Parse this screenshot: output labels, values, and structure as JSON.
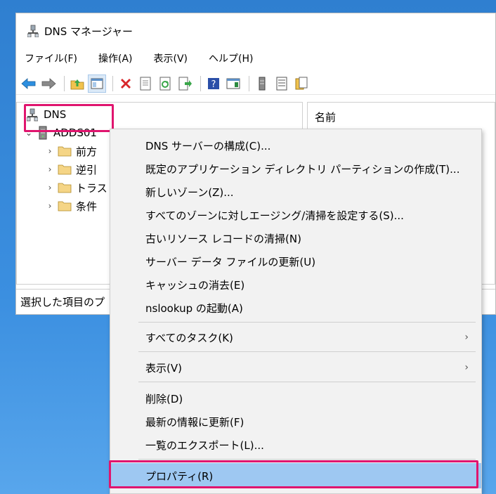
{
  "window": {
    "title": "DNS マネージャー",
    "menu": [
      "ファイル(F)",
      "操作(A)",
      "表示(V)",
      "ヘルプ(H)"
    ]
  },
  "toolbar": {
    "icons": [
      "back-arrow-icon",
      "forward-arrow-icon",
      "up-folder-icon",
      "show-hide-tree-icon",
      "delete-icon",
      "properties-icon",
      "refresh-icon",
      "export-list-icon",
      "help-icon",
      "show-hide-action-pane-icon",
      "server-icon",
      "list-icon",
      "new-window-icon"
    ]
  },
  "tree": {
    "root": "DNS",
    "server": "ADDS01",
    "children": [
      "前方",
      "逆引",
      "トラス",
      "条件"
    ]
  },
  "right_pane": {
    "column_header": "名前"
  },
  "statusbar": {
    "text": "選択した項目のプ"
  },
  "context_menu": {
    "groups": [
      [
        "DNS サーバーの構成(C)...",
        "既定のアプリケーション ディレクトリ パーティションの作成(T)...",
        "新しいゾーン(Z)...",
        "すべてのゾーンに対しエージング/清掃を設定する(S)...",
        "古いリソース レコードの清掃(N)",
        "サーバー データ ファイルの更新(U)",
        "キャッシュの消去(E)",
        "nslookup の起動(A)"
      ],
      [
        "すべてのタスク(K)"
      ],
      [
        "表示(V)"
      ],
      [
        "削除(D)",
        "最新の情報に更新(F)",
        "一覧のエクスポート(L)..."
      ],
      [
        "プロパティ(R)"
      ]
    ],
    "submenu_arrow": "›"
  },
  "colors": {
    "accent_highlight": "#e0156e",
    "selection": "#9ec8f2",
    "desktop": "#3b8fe0"
  }
}
